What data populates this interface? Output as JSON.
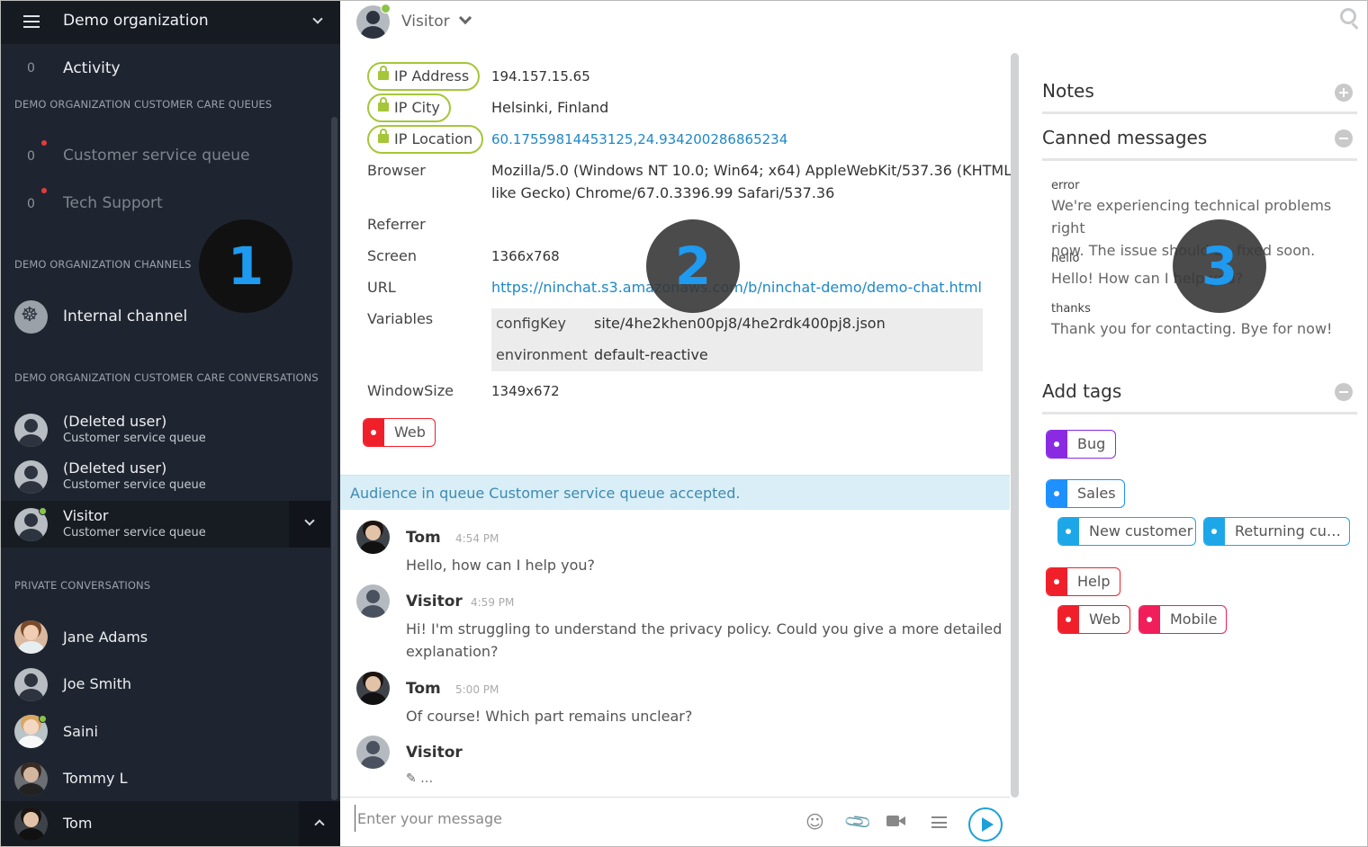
{
  "sidebar": {
    "org_name": "Demo organization",
    "activity": {
      "count": "0",
      "label": "Activity"
    },
    "queues_heading": "DEMO ORGANIZATION CUSTOMER CARE QUEUES",
    "queues": [
      {
        "count": "0",
        "label": "Customer service queue"
      },
      {
        "count": "0",
        "label": "Tech Support"
      }
    ],
    "channels_heading": "DEMO ORGANIZATION CHANNELS",
    "channels": [
      {
        "label": "Internal channel"
      }
    ],
    "conversations_heading": "DEMO ORGANIZATION CUSTOMER CARE CONVERSATIONS",
    "conversations": [
      {
        "name": "(Deleted user)",
        "queue": "Customer service queue"
      },
      {
        "name": "(Deleted user)",
        "queue": "Customer service queue"
      },
      {
        "name": "Visitor",
        "queue": "Customer service queue"
      }
    ],
    "private_heading": "PRIVATE CONVERSATIONS",
    "private": [
      {
        "name": "Jane Adams"
      },
      {
        "name": "Joe Smith"
      },
      {
        "name": "Saini"
      },
      {
        "name": "Tommy L"
      }
    ],
    "current_user": "Tom"
  },
  "header": {
    "visitor_name": "Visitor"
  },
  "info": {
    "ip_address_label": "IP Address",
    "ip_address": "194.157.15.65",
    "ip_city_label": "IP City",
    "ip_city": "Helsinki, Finland",
    "ip_location_label": "IP Location",
    "ip_location": "60.17559814453125,24.934200286865234",
    "browser_label": "Browser",
    "browser_line1": "Mozilla/5.0 (Windows NT 10.0; Win64; x64) AppleWebKit/537.36 (KHTML,",
    "browser_line2": "like Gecko) Chrome/67.0.3396.99 Safari/537.36",
    "referrer_label": "Referrer",
    "screen_label": "Screen",
    "screen": "1366x768",
    "url_label": "URL",
    "url": "https://ninchat.s3.amazonaws.com/b/ninchat-demo/demo-chat.html",
    "variables_label": "Variables",
    "variables": [
      {
        "key": "configKey",
        "value": "site/4he2khen00pj8/4he2rdk400pj8.json"
      },
      {
        "key": "environment",
        "value": "default-reactive"
      }
    ],
    "windowsize_label": "WindowSize",
    "windowsize": "1349x672",
    "tag": "Web"
  },
  "chat": {
    "notice": "Audience in queue Customer service queue accepted.",
    "messages": [
      {
        "author": "Tom",
        "time": "4:54 PM",
        "lines": [
          "Hello, how can I help you?"
        ]
      },
      {
        "author": "Visitor",
        "time": "4:59 PM",
        "lines": [
          "Hi! I'm struggling to understand the privacy policy. Could you give a more detailed",
          "explanation?"
        ]
      },
      {
        "author": "Tom",
        "time": "5:00 PM",
        "lines": [
          "Of course! Which part remains unclear?"
        ]
      },
      {
        "author": "Visitor",
        "time": "",
        "lines": []
      }
    ],
    "typing": "✎ …",
    "composer_placeholder": "Enter your message"
  },
  "right": {
    "notes_title": "Notes",
    "canned_title": "Canned messages",
    "canned": [
      {
        "key": "error",
        "lines": [
          "We're experiencing technical problems right",
          "now. The issue should be fixed soon."
        ]
      },
      {
        "key": "hello",
        "lines": [
          "Hello! How can I help you?"
        ]
      },
      {
        "key": "thanks",
        "lines": [
          "Thank you for contacting. Bye for now!"
        ]
      }
    ],
    "tags_title": "Add tags",
    "tags": [
      {
        "label": "Bug",
        "color": "#8a2be2"
      },
      {
        "label": "Sales",
        "color": "#1e90ff"
      },
      {
        "label": "New customer",
        "color": "#1ea7e8"
      },
      {
        "label": "Returning cu…",
        "color": "#1ea7e8"
      },
      {
        "label": "Help",
        "color": "#f0202a"
      },
      {
        "label": "Web",
        "color": "#f0202a"
      },
      {
        "label": "Mobile",
        "color": "#f01e5a"
      }
    ]
  },
  "overlays": {
    "badge1": "1",
    "badge2": "2",
    "badge3": "3"
  },
  "colors": {
    "sidebar": "#1f2530",
    "lock_green": "#a5c639",
    "link": "#1e88c8",
    "send": "#1ea0d8",
    "badge_text": "#1e9af0"
  },
  "icons": [
    "hamburger-icon",
    "chevron-down-icon",
    "search-icon",
    "lock-icon",
    "smiley-icon",
    "paperclip-icon",
    "video-icon",
    "menu-icon",
    "send-icon",
    "plus-circle-icon",
    "minus-circle-icon",
    "pencil-icon"
  ]
}
